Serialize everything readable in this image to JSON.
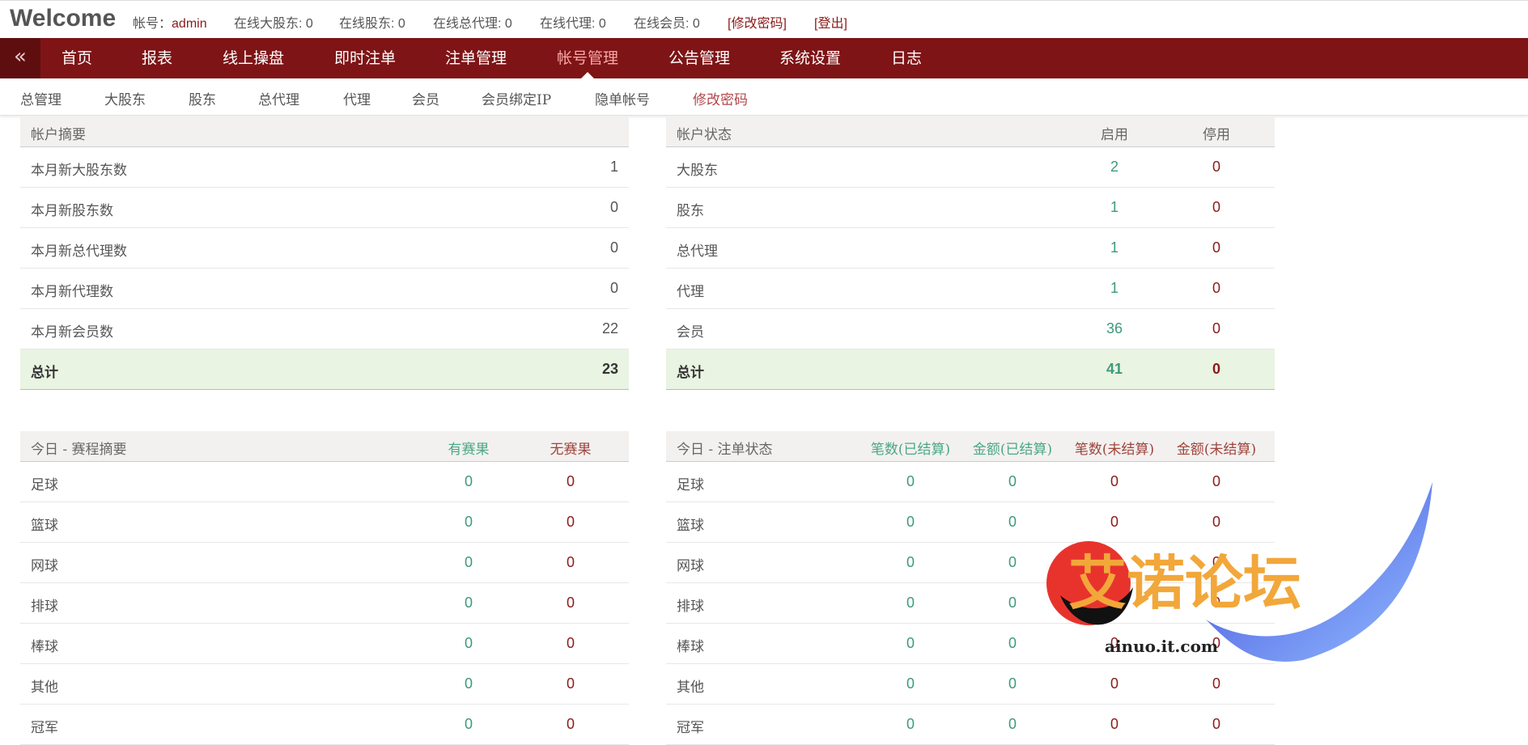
{
  "header": {
    "brand": "Welcome",
    "account_label": "帐号：",
    "account_value": "admin",
    "online_major_label": "在线大股东: ",
    "online_major_value": "0",
    "online_shareholder_label": "在线股东: ",
    "online_shareholder_value": "0",
    "online_general_agent_label": "在线总代理: ",
    "online_general_agent_value": "0",
    "online_agent_label": "在线代理: ",
    "online_agent_value": "0",
    "online_member_label": "在线会员: ",
    "online_member_value": "0",
    "change_password": "[修改密码]",
    "logout": "[登出]"
  },
  "nav": {
    "collapse_glyph": "«",
    "items": [
      "首页",
      "报表",
      "线上操盘",
      "即时注单",
      "注单管理",
      "帐号管理",
      "公告管理",
      "系统设置",
      "日志"
    ],
    "active_index": 5
  },
  "subnav": {
    "items": [
      "总管理",
      "大股东",
      "股东",
      "总代理",
      "代理",
      "会员",
      "会员绑定IP",
      "隐单帐号",
      "修改密码"
    ],
    "active_index": 8
  },
  "summary": {
    "title": "帐户摘要",
    "rows": [
      {
        "label": "本月新大股东数",
        "value": "1"
      },
      {
        "label": "本月新股东数",
        "value": "0"
      },
      {
        "label": "本月新总代理数",
        "value": "0"
      },
      {
        "label": "本月新代理数",
        "value": "0"
      },
      {
        "label": "本月新会员数",
        "value": "22"
      }
    ],
    "total": {
      "label": "总计",
      "value": "23"
    }
  },
  "status": {
    "title": "帐户状态",
    "col_enabled": "启用",
    "col_disabled": "停用",
    "rows": [
      {
        "label": "大股东",
        "enabled": "2",
        "disabled": "0"
      },
      {
        "label": "股东",
        "enabled": "1",
        "disabled": "0"
      },
      {
        "label": "总代理",
        "enabled": "1",
        "disabled": "0"
      },
      {
        "label": "代理",
        "enabled": "1",
        "disabled": "0"
      },
      {
        "label": "会员",
        "enabled": "36",
        "disabled": "0"
      }
    ],
    "total": {
      "label": "总计",
      "enabled": "41",
      "disabled": "0"
    }
  },
  "events": {
    "title": "今日 - 赛程摘要",
    "col_result": "有赛果",
    "col_noresult": "无赛果",
    "rows": [
      {
        "label": "足球",
        "result": "0",
        "noresult": "0"
      },
      {
        "label": "篮球",
        "result": "0",
        "noresult": "0"
      },
      {
        "label": "网球",
        "result": "0",
        "noresult": "0"
      },
      {
        "label": "排球",
        "result": "0",
        "noresult": "0"
      },
      {
        "label": "棒球",
        "result": "0",
        "noresult": "0"
      },
      {
        "label": "其他",
        "result": "0",
        "noresult": "0"
      },
      {
        "label": "冠军",
        "result": "0",
        "noresult": "0"
      }
    ]
  },
  "bets": {
    "title": "今日 - 注单状态",
    "col1": "笔数(已结算)",
    "col2": "金额(已结算)",
    "col3": "笔数(未结算)",
    "col4": "金额(未结算)",
    "rows": [
      {
        "label": "足球",
        "v": [
          "0",
          "0",
          "0",
          "0"
        ]
      },
      {
        "label": "篮球",
        "v": [
          "0",
          "0",
          "0",
          "0"
        ]
      },
      {
        "label": "网球",
        "v": [
          "0",
          "0",
          "0",
          "0"
        ]
      },
      {
        "label": "排球",
        "v": [
          "0",
          "0",
          "0",
          "0"
        ]
      },
      {
        "label": "棒球",
        "v": [
          "0",
          "0",
          "0",
          "0"
        ]
      },
      {
        "label": "其他",
        "v": [
          "0",
          "0",
          "0",
          "0"
        ]
      },
      {
        "label": "冠军",
        "v": [
          "0",
          "0",
          "0",
          "0"
        ]
      }
    ]
  },
  "watermark": {
    "text": "艾诺论坛",
    "url": "ainuo.it.com"
  }
}
